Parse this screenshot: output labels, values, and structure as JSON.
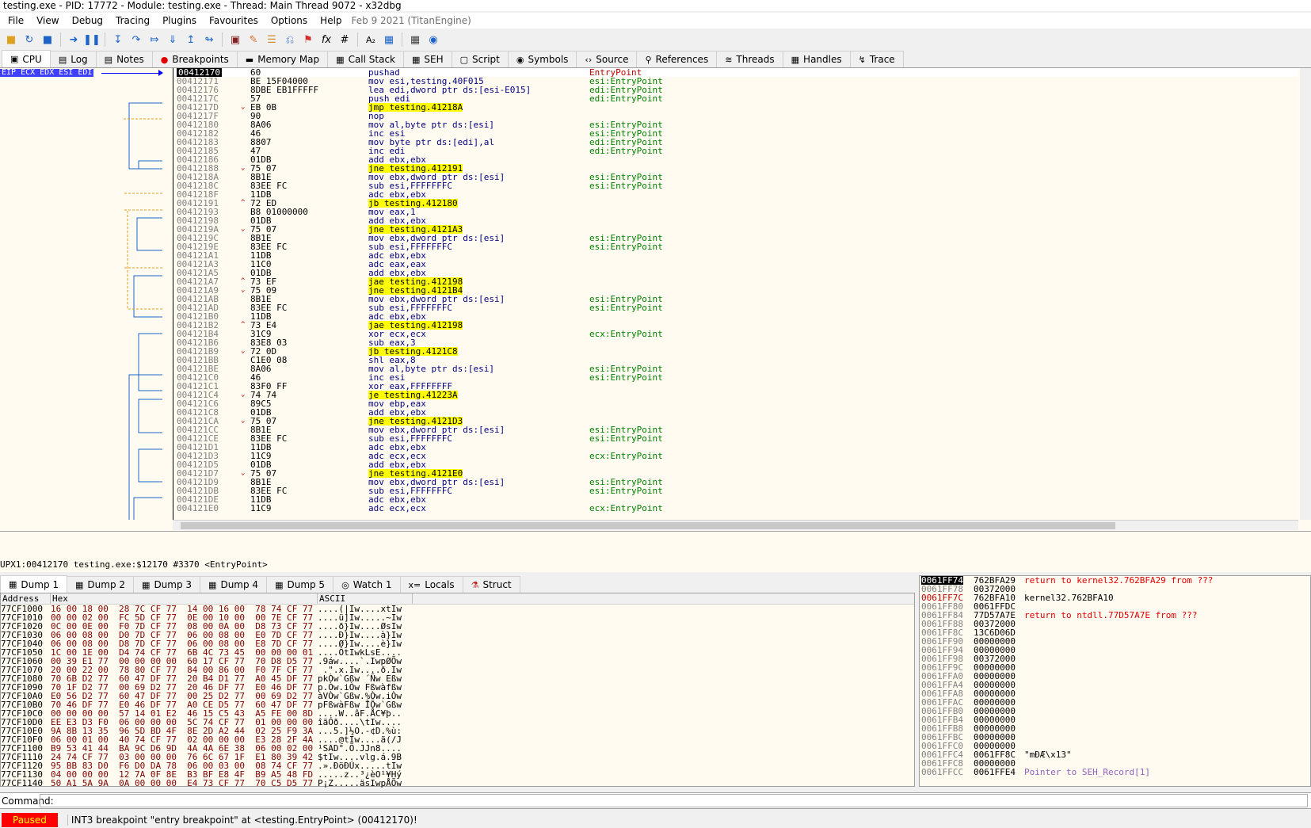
{
  "title": "testing.exe - PID: 17772 - Module: testing.exe - Thread: Main Thread 9072 - x32dbg",
  "menu": [
    "File",
    "View",
    "Debug",
    "Tracing",
    "Plugins",
    "Favourites",
    "Options",
    "Help"
  ],
  "version": "Feb 9 2021 (TitanEngine)",
  "tabs": [
    "CPU",
    "Log",
    "Notes",
    "Breakpoints",
    "Memory Map",
    "Call Stack",
    "SEH",
    "Script",
    "Symbols",
    "Source",
    "References",
    "Threads",
    "Handles",
    "Trace"
  ],
  "reg_label": "EIP ECX EDX ESI EDI",
  "disasm": [
    {
      "a": "00412170",
      "b": "60",
      "i": "pushad",
      "c": "EntryPoint",
      "cur": true
    },
    {
      "a": "00412171",
      "b": "BE 15F04000",
      "i": "mov esi,testing.40F015",
      "c": "esi:EntryPoint"
    },
    {
      "a": "00412176",
      "b": "8DBE EB1FFFFF",
      "i": "lea edi,dword ptr ds:[esi-E015]",
      "c": "edi:EntryPoint"
    },
    {
      "a": "0041217C",
      "b": "57",
      "i": "push edi",
      "c": "edi:EntryPoint"
    },
    {
      "a": "0041217D",
      "b": "EB 0B",
      "i": "jmp testing.41218A",
      "c": "",
      "t": "jmp",
      "ar": "v"
    },
    {
      "a": "0041217F",
      "b": "90",
      "i": "nop",
      "c": ""
    },
    {
      "a": "00412180",
      "b": "8A06",
      "i": "mov al,byte ptr ds:[esi]",
      "c": "esi:EntryPoint"
    },
    {
      "a": "00412182",
      "b": "46",
      "i": "inc esi",
      "c": "esi:EntryPoint"
    },
    {
      "a": "00412183",
      "b": "8807",
      "i": "mov byte ptr ds:[edi],al",
      "c": "edi:EntryPoint"
    },
    {
      "a": "00412185",
      "b": "47",
      "i": "inc edi",
      "c": "edi:EntryPoint"
    },
    {
      "a": "00412186",
      "b": "01DB",
      "i": "add ebx,ebx",
      "c": ""
    },
    {
      "a": "00412188",
      "b": "75 07",
      "i": "jne testing.412191",
      "c": "",
      "t": "jcc",
      "ar": "v"
    },
    {
      "a": "0041218A",
      "b": "8B1E",
      "i": "mov ebx,dword ptr ds:[esi]",
      "c": "esi:EntryPoint"
    },
    {
      "a": "0041218C",
      "b": "83EE FC",
      "i": "sub esi,FFFFFFFC",
      "c": "esi:EntryPoint"
    },
    {
      "a": "0041218F",
      "b": "11DB",
      "i": "adc ebx,ebx",
      "c": ""
    },
    {
      "a": "00412191",
      "b": "72 ED",
      "i": "jb testing.412180",
      "c": "",
      "t": "jcc",
      "ar": "^"
    },
    {
      "a": "00412193",
      "b": "B8 01000000",
      "i": "mov eax,1",
      "c": ""
    },
    {
      "a": "00412198",
      "b": "01DB",
      "i": "add ebx,ebx",
      "c": ""
    },
    {
      "a": "0041219A",
      "b": "75 07",
      "i": "jne testing.4121A3",
      "c": "",
      "t": "jcc",
      "ar": "v"
    },
    {
      "a": "0041219C",
      "b": "8B1E",
      "i": "mov ebx,dword ptr ds:[esi]",
      "c": "esi:EntryPoint"
    },
    {
      "a": "0041219E",
      "b": "83EE FC",
      "i": "sub esi,FFFFFFFC",
      "c": "esi:EntryPoint"
    },
    {
      "a": "004121A1",
      "b": "11DB",
      "i": "adc ebx,ebx",
      "c": ""
    },
    {
      "a": "004121A3",
      "b": "11C0",
      "i": "adc eax,eax",
      "c": ""
    },
    {
      "a": "004121A5",
      "b": "01DB",
      "i": "add ebx,ebx",
      "c": ""
    },
    {
      "a": "004121A7",
      "b": "73 EF",
      "i": "jae testing.412198",
      "c": "",
      "t": "jcc",
      "ar": "^"
    },
    {
      "a": "004121A9",
      "b": "75 09",
      "i": "jne testing.4121B4",
      "c": "",
      "t": "jcc",
      "ar": "v"
    },
    {
      "a": "004121AB",
      "b": "8B1E",
      "i": "mov ebx,dword ptr ds:[esi]",
      "c": "esi:EntryPoint"
    },
    {
      "a": "004121AD",
      "b": "83EE FC",
      "i": "sub esi,FFFFFFFC",
      "c": "esi:EntryPoint"
    },
    {
      "a": "004121B0",
      "b": "11DB",
      "i": "adc ebx,ebx",
      "c": ""
    },
    {
      "a": "004121B2",
      "b": "73 E4",
      "i": "jae testing.412198",
      "c": "",
      "t": "jcc",
      "ar": "^"
    },
    {
      "a": "004121B4",
      "b": "31C9",
      "i": "xor ecx,ecx",
      "c": "ecx:EntryPoint"
    },
    {
      "a": "004121B6",
      "b": "83E8 03",
      "i": "sub eax,3",
      "c": ""
    },
    {
      "a": "004121B9",
      "b": "72 0D",
      "i": "jb testing.4121C8",
      "c": "",
      "t": "jcc",
      "ar": "v"
    },
    {
      "a": "004121BB",
      "b": "C1E0 08",
      "i": "shl eax,8",
      "c": ""
    },
    {
      "a": "004121BE",
      "b": "8A06",
      "i": "mov al,byte ptr ds:[esi]",
      "c": "esi:EntryPoint"
    },
    {
      "a": "004121C0",
      "b": "46",
      "i": "inc esi",
      "c": "esi:EntryPoint"
    },
    {
      "a": "004121C1",
      "b": "83F0 FF",
      "i": "xor eax,FFFFFFFF",
      "c": ""
    },
    {
      "a": "004121C4",
      "b": "74 74",
      "i": "je testing.41223A",
      "c": "",
      "t": "jcc",
      "ar": "v"
    },
    {
      "a": "004121C6",
      "b": "89C5",
      "i": "mov ebp,eax",
      "c": ""
    },
    {
      "a": "004121C8",
      "b": "01DB",
      "i": "add ebx,ebx",
      "c": ""
    },
    {
      "a": "004121CA",
      "b": "75 07",
      "i": "jne testing.4121D3",
      "c": "",
      "t": "jcc",
      "ar": "v"
    },
    {
      "a": "004121CC",
      "b": "8B1E",
      "i": "mov ebx,dword ptr ds:[esi]",
      "c": "esi:EntryPoint"
    },
    {
      "a": "004121CE",
      "b": "83EE FC",
      "i": "sub esi,FFFFFFFC",
      "c": "esi:EntryPoint"
    },
    {
      "a": "004121D1",
      "b": "11DB",
      "i": "adc ebx,ebx",
      "c": ""
    },
    {
      "a": "004121D3",
      "b": "11C9",
      "i": "adc ecx,ecx",
      "c": "ecx:EntryPoint"
    },
    {
      "a": "004121D5",
      "b": "01DB",
      "i": "add ebx,ebx",
      "c": ""
    },
    {
      "a": "004121D7",
      "b": "75 07",
      "i": "jne testing.4121E0",
      "c": "",
      "t": "jcc",
      "ar": "v"
    },
    {
      "a": "004121D9",
      "b": "8B1E",
      "i": "mov ebx,dword ptr ds:[esi]",
      "c": "esi:EntryPoint"
    },
    {
      "a": "004121DB",
      "b": "83EE FC",
      "i": "sub esi,FFFFFFFC",
      "c": "esi:EntryPoint"
    },
    {
      "a": "004121DE",
      "b": "11DB",
      "i": "adc ebx,ebx",
      "c": ""
    },
    {
      "a": "004121E0",
      "b": "11C9",
      "i": "adc ecx,ecx",
      "c": "ecx:EntryPoint"
    }
  ],
  "info_line": "UPX1:00412170 testing.exe:$12170 #3370 <EntryPoint>",
  "dump_tabs": [
    "Dump 1",
    "Dump 2",
    "Dump 3",
    "Dump 4",
    "Dump 5",
    "Watch 1",
    "Locals",
    "Struct"
  ],
  "dump_headers": [
    "Address",
    "Hex",
    "ASCII"
  ],
  "dump": [
    {
      "a": "77CF1000",
      "h": "16 00 18 00  28 7C CF 77  14 00 16 00  78 74 CF 77",
      "s": "....(|Iw....xtIw"
    },
    {
      "a": "77CF1010",
      "h": "00 00 02 00  FC 5D CF 77  0E 00 10 00  00 7E CF 77",
      "s": "....ü]Iw.....~Iw"
    },
    {
      "a": "77CF1020",
      "h": "0C 00 0E 00  F0 7D CF 77  08 00 0A 00  D8 73 CF 77",
      "s": "....ð}Iw....ØsIw"
    },
    {
      "a": "77CF1030",
      "h": "06 00 08 00  D0 7D CF 77  06 00 08 00  E0 7D CF 77",
      "s": "....Ð}Iw....à}Iw"
    },
    {
      "a": "77CF1040",
      "h": "06 00 08 00  D8 7D CF 77  06 00 08 00  E8 7D CF 77",
      "s": "....Ø}Iw....è}Iw"
    },
    {
      "a": "77CF1050",
      "h": "1C 00 1E 00  D4 74 CF 77  6B 4C 73 45  00 00 00 01",
      "s": "....ÔtIwkLsE...."
    },
    {
      "a": "77CF1060",
      "h": "00 39 E1 77  00 00 00 00  60 17 CF 77  70 D8 D5 77",
      "s": ".9áw....`.IwpØÕw"
    },
    {
      "a": "77CF1070",
      "h": "20 00 22 00  78 80 CF 77  84 00 86 00  F0 7F CF 77",
      "s": " .\".x.Iw....ð.Iw"
    },
    {
      "a": "77CF1080",
      "h": "70 6B D2 77  60 47 DF 77  20 B4 D1 77  A0 45 DF 77",
      "s": "pkÒw`Gßw ´Ñw Eßw"
    },
    {
      "a": "77CF1090",
      "h": "70 1F D2 77  00 69 D2 77  20 46 DF 77  E0 46 DF 77",
      "s": "p.Òw.iÒw Fßwàfßw"
    },
    {
      "a": "77CF10A0",
      "h": "E0 56 D2 77  60 47 DF 77  00 25 D2 77  00 69 D2 77",
      "s": "àVÒw`Gßw.%Òw.iÒw"
    },
    {
      "a": "77CF10B0",
      "h": "70 46 DF 77  E0 46 DF 77  A0 CE D5 77  60 47 DF 77",
      "s": "pFßwàFßw ÎÕw`Gßw"
    },
    {
      "a": "77CF10C0",
      "h": "00 00 00 00  57 14 01 E2  46 15 C5 43  A5 FE 00 8D",
      "s": "....W..âF.ÅC¥þ.."
    },
    {
      "a": "77CF10D0",
      "h": "EE E3 D3 F0  06 00 00 00  5C 74 CF 77  01 00 00 00",
      "s": "îãÓð....\\tIw...."
    },
    {
      "a": "77CF10E0",
      "h": "9A 8B 13 35  96 5D BD 4F  8E 2D A2 44  02 25 F9 3A",
      "s": "...5.]½O.-¢D.%ù:"
    },
    {
      "a": "77CF10F0",
      "h": "06 00 01 00  40 74 CF 77  02 00 00 00  E3 28 2F 4A",
      "s": "....@tIw....ã(/J"
    },
    {
      "a": "77CF1100",
      "h": "B9 53 41 44  BA 9C D6 9D  4A 4A 6E 38  06 00 02 00",
      "s": "¹SAD°.Ö.JJn8...."
    },
    {
      "a": "77CF1110",
      "h": "24 74 CF 77  03 00 00 00  76 6C 67 1F  E1 80 39 42",
      "s": "$tIw....vlg.á.9B"
    },
    {
      "a": "77CF1120",
      "h": "95 BB 83 D0  F6 D0 DA 78  06 00 03 00  08 74 CF 77",
      "s": ".».ÐöÐÚx.....tIw"
    },
    {
      "a": "77CF1130",
      "h": "04 00 00 00  12 7A 0F 8E  B3 BF E8 4F  B9 A5 48 FD",
      "s": ".....z..³¿èO¹¥Hý"
    },
    {
      "a": "77CF1140",
      "h": "50 A1 5A 9A  0A 00 00 00  E4 73 CF 77  70 C5 D5 77",
      "s": "P¡Z.....äsIwpÅÕw"
    }
  ],
  "stack": [
    {
      "a": "0061FF74",
      "v": "762BFA29",
      "c": "return to kernel32.762BFA29 from ???",
      "top": true,
      "red": true
    },
    {
      "a": "0061FF78",
      "v": "00372000",
      "c": ""
    },
    {
      "a": "0061FF7C",
      "v": "762BFA10",
      "c": "kernel32.762BFA10"
    },
    {
      "a": "0061FF80",
      "v": "0061FFDC",
      "c": ""
    },
    {
      "a": "0061FF84",
      "v": "77D57A7E",
      "c": "return to ntdll.77D57A7E from ???",
      "red": true
    },
    {
      "a": "0061FF88",
      "v": "00372000",
      "c": ""
    },
    {
      "a": "0061FF8C",
      "v": "13C6D06D",
      "c": ""
    },
    {
      "a": "0061FF90",
      "v": "00000000",
      "c": ""
    },
    {
      "a": "0061FF94",
      "v": "00000000",
      "c": ""
    },
    {
      "a": "0061FF98",
      "v": "00372000",
      "c": ""
    },
    {
      "a": "0061FF9C",
      "v": "00000000",
      "c": ""
    },
    {
      "a": "0061FFA0",
      "v": "00000000",
      "c": ""
    },
    {
      "a": "0061FFA4",
      "v": "00000000",
      "c": ""
    },
    {
      "a": "0061FFA8",
      "v": "00000000",
      "c": ""
    },
    {
      "a": "0061FFAC",
      "v": "00000000",
      "c": ""
    },
    {
      "a": "0061FFB0",
      "v": "00000000",
      "c": ""
    },
    {
      "a": "0061FFB4",
      "v": "00000000",
      "c": ""
    },
    {
      "a": "0061FFB8",
      "v": "00000000",
      "c": ""
    },
    {
      "a": "0061FFBC",
      "v": "00000000",
      "c": ""
    },
    {
      "a": "0061FFC0",
      "v": "00000000",
      "c": ""
    },
    {
      "a": "0061FFC4",
      "v": "0061FF8C",
      "c": "\"mÐÆ\\x13\""
    },
    {
      "a": "0061FFC8",
      "v": "00000000",
      "c": ""
    },
    {
      "a": "0061FFCC",
      "v": "0061FFE4",
      "c": "Pointer to SEH_Record[1]",
      "purple": true
    }
  ],
  "command_label": "Command:",
  "status": "Paused",
  "status_msg": "INT3 breakpoint \"entry breakpoint\" at <testing.EntryPoint> (00412170)!"
}
